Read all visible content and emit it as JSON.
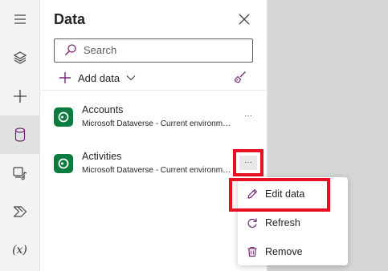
{
  "rail": {
    "items": [
      {
        "icon": "hamburger-menu-icon"
      },
      {
        "icon": "layers-icon"
      },
      {
        "icon": "plus-icon"
      },
      {
        "icon": "database-icon",
        "active": true
      },
      {
        "icon": "media-icon"
      },
      {
        "icon": "power-automate-icon"
      },
      {
        "icon": "variables-icon",
        "text": "(x)"
      }
    ]
  },
  "panel": {
    "title": "Data",
    "search": {
      "placeholder": "Search",
      "value": ""
    },
    "add_data_label": "Add data"
  },
  "data_sources": [
    {
      "name": "Accounts",
      "subtitle": "Microsoft Dataverse - Current environment"
    },
    {
      "name": "Activities",
      "subtitle": "Microsoft Dataverse - Current environment"
    }
  ],
  "more_glyph": "···",
  "context_menu": {
    "items": [
      {
        "label": "Edit data",
        "icon": "pencil-icon"
      },
      {
        "label": "Refresh",
        "icon": "refresh-icon"
      },
      {
        "label": "Remove",
        "icon": "trash-icon"
      }
    ]
  },
  "colors": {
    "accent": "#742774",
    "highlight": "#e81123",
    "dataverse": "#0b7b3e"
  }
}
